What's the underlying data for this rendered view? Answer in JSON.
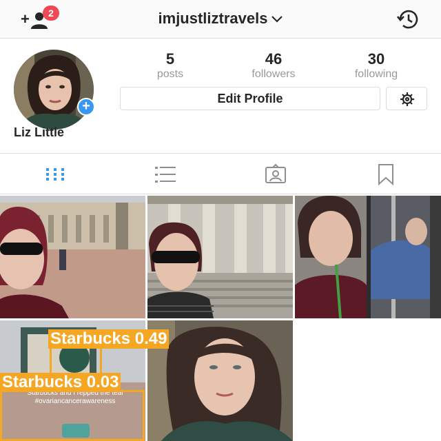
{
  "header": {
    "username": "imjustliztravels",
    "notification_count": "2"
  },
  "profile": {
    "full_name": "Liz Little",
    "stats": [
      {
        "value": "5",
        "label": "posts"
      },
      {
        "value": "46",
        "label": "followers"
      },
      {
        "value": "30",
        "label": "following"
      }
    ],
    "edit_label": "Edit Profile"
  },
  "detections": [
    {
      "label": "Starbucks 0.49"
    },
    {
      "label": "Starbucks 0.03"
    }
  ],
  "overlay_text": {
    "line1": "Starbucks and I repped the teal",
    "line2": "#ovariancancerawareness"
  },
  "colors": {
    "accent": "#3897f0",
    "badge": "#ed4956",
    "detection_box": "#f5a623"
  },
  "icons": {
    "tab_grid": "grid-icon",
    "tab_list": "list-icon",
    "tab_tagged": "tagged-photos-icon",
    "tab_saved": "bookmark-icon"
  }
}
